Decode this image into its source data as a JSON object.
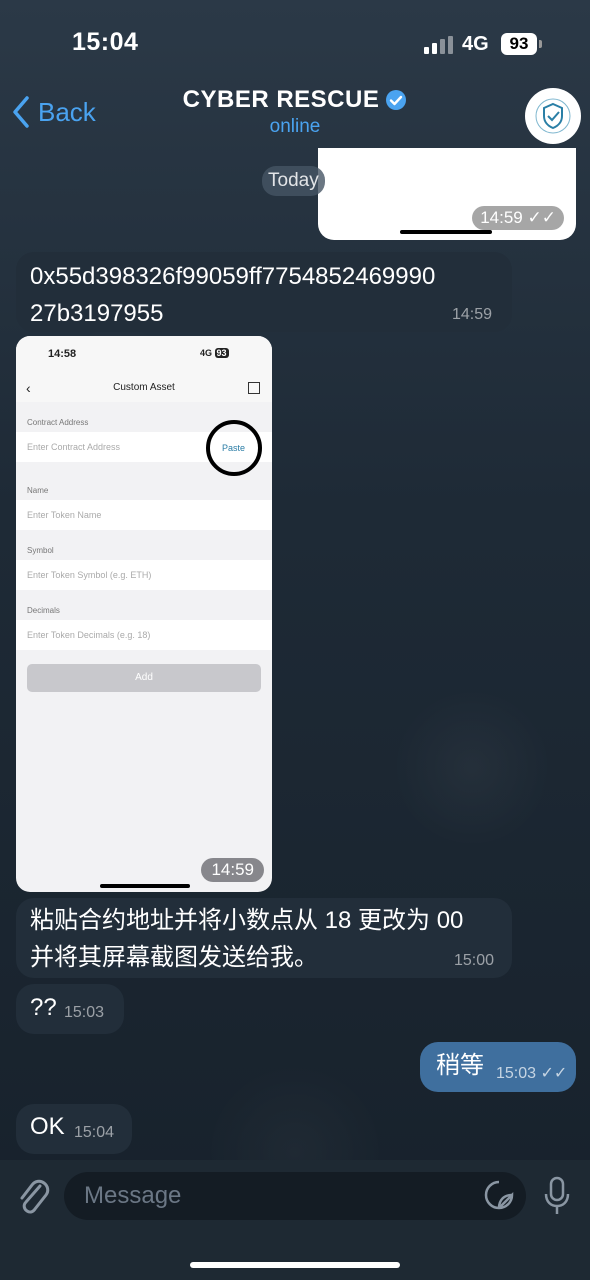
{
  "status": {
    "time": "15:04",
    "network": "4G",
    "battery": "93"
  },
  "header": {
    "back_label": "Back",
    "title": "CYBER RESCUE",
    "subtitle": "online"
  },
  "date_separator": "Today",
  "messages": [
    {
      "dir": "out",
      "type": "image",
      "time": "14:59"
    },
    {
      "dir": "in",
      "type": "text",
      "line1": "0x55d398326f99059ff7754852469990",
      "line2": "27b3197955",
      "time": "14:59"
    },
    {
      "dir": "in",
      "type": "image",
      "time": "14:59"
    },
    {
      "dir": "in",
      "type": "text",
      "line1": "粘贴合约地址并将小数点从 18 更改为 00",
      "line2": "并将其屏幕截图发送给我。",
      "time": "15:00"
    },
    {
      "dir": "in",
      "type": "text",
      "text": "??",
      "time": "15:03"
    },
    {
      "dir": "out",
      "type": "text",
      "text": "稍等",
      "time": "15:03"
    },
    {
      "dir": "in",
      "type": "text",
      "text": "OK",
      "time": "15:04"
    }
  ],
  "screenshot": {
    "time": "14:58",
    "status_right": "4G",
    "battery": "93",
    "title": "Custom Asset",
    "fields": [
      {
        "label": "Contract Address",
        "placeholder": "Enter Contract Address"
      },
      {
        "label": "Name",
        "placeholder": "Enter Token Name"
      },
      {
        "label": "Symbol",
        "placeholder": "Enter Token Symbol (e.g. ETH)"
      },
      {
        "label": "Decimals",
        "placeholder": "Enter Token Decimals (e.g. 18)"
      }
    ],
    "paste_label": "Paste",
    "add_label": "Add"
  },
  "composer": {
    "placeholder": "Message"
  },
  "colors": {
    "accent": "#4aa3f0",
    "bubble_in": "#222e3a",
    "bubble_out": "#3f6f9e"
  }
}
